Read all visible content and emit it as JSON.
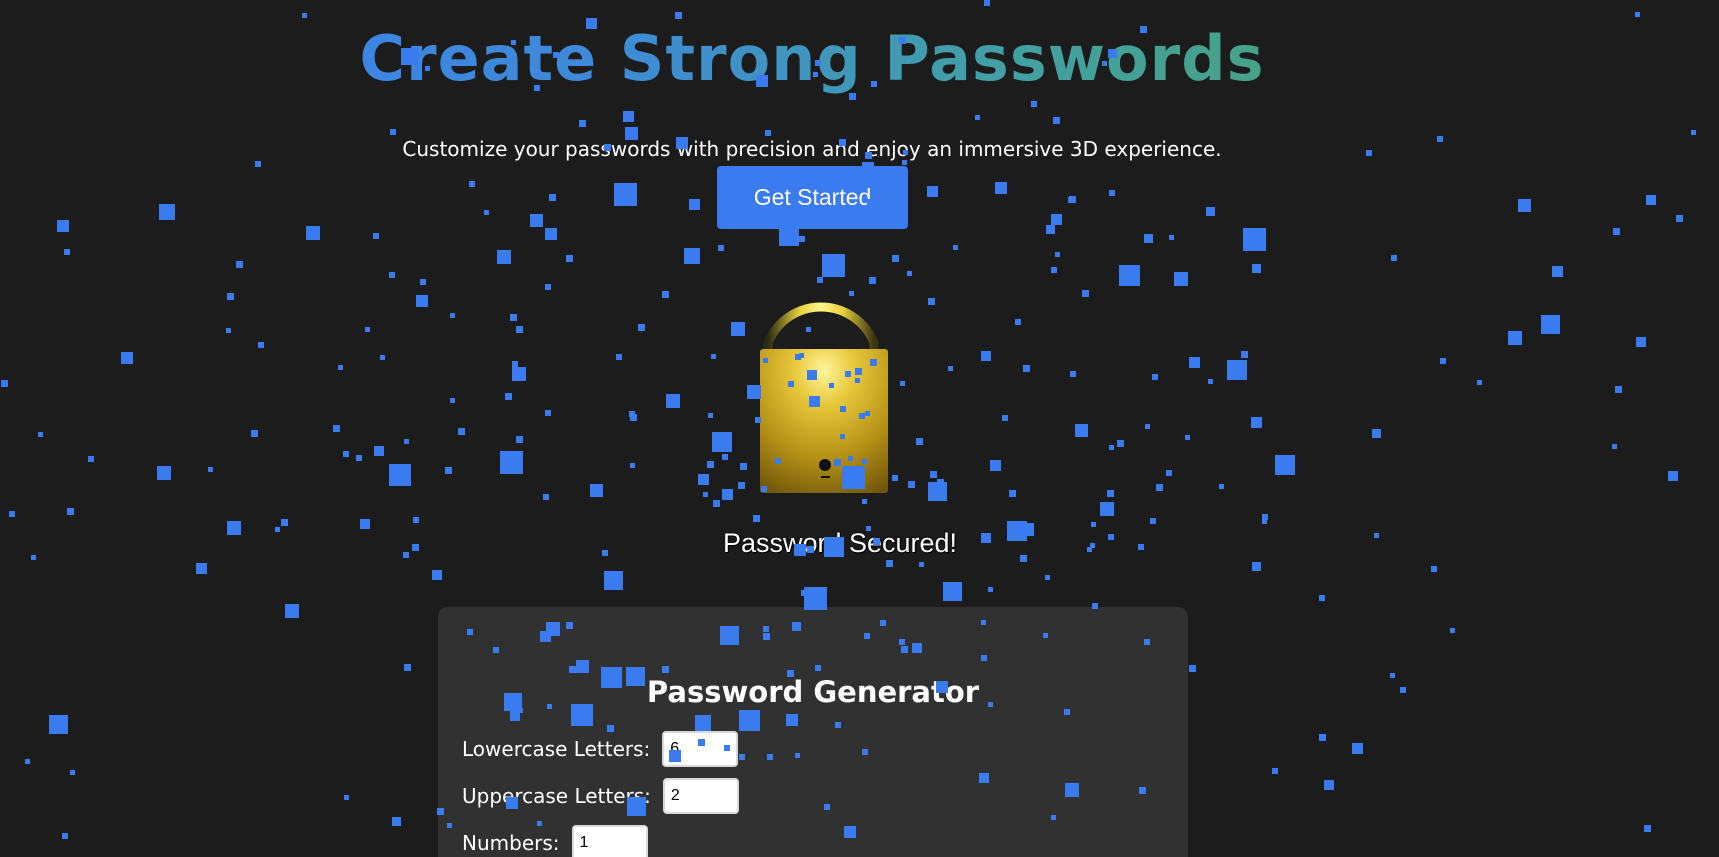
{
  "hero": {
    "title": "Create Strong Passwords",
    "subtitle": "Customize your passwords with precision and enjoy an immersive 3D experience.",
    "cta_label": "Get Started"
  },
  "lock": {
    "icon": "padlock-icon",
    "status_text": "Password Secured!"
  },
  "generator": {
    "title": "Password Generator",
    "fields": [
      {
        "label": "Lowercase Letters:",
        "value": "6"
      },
      {
        "label": "Uppercase Letters:",
        "value": "2"
      },
      {
        "label": "Numbers:",
        "value": "1"
      }
    ]
  },
  "colors": {
    "background": "#1c1c1c",
    "accent": "#3a7bf0",
    "panel": "#313131",
    "title_gradient_start": "#3c7cf4",
    "title_gradient_end": "#4ca55f",
    "lock_gold": "#d9b22a"
  }
}
